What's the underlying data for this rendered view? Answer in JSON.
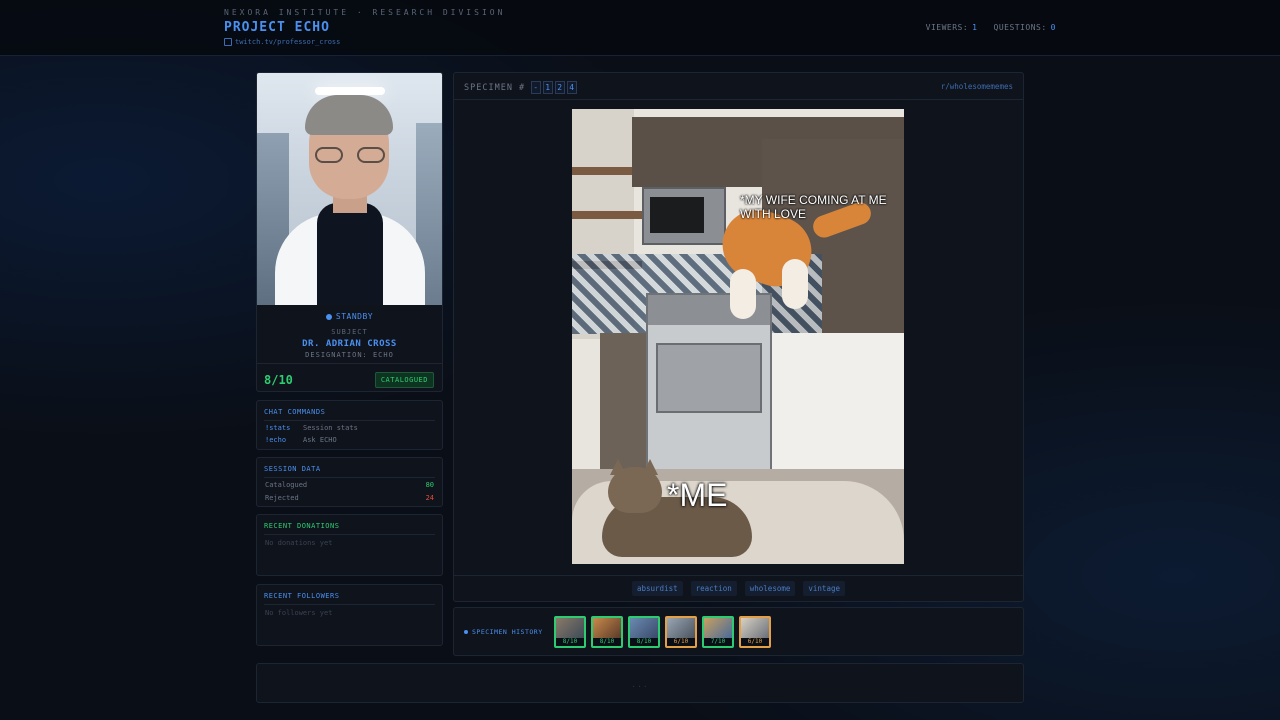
{
  "header": {
    "org": "NEXORA INSTITUTE · RESEARCH DIVISION",
    "title": "PROJECT ECHO",
    "channel": "twitch.tv/professor_cross",
    "viewers_label": "VIEWERS:",
    "viewers": "1",
    "questions_label": "QUESTIONS:",
    "questions": "0"
  },
  "subject": {
    "status": "STANDBY",
    "label": "SUBJECT",
    "name": "DR. ADRIAN CROSS",
    "designation": "DESIGNATION: ECHO",
    "score": "8/10",
    "badge": "CATALOGUED"
  },
  "commands": {
    "title": "CHAT COMMANDS",
    "items": [
      {
        "cmd": "!stats",
        "desc": "Session stats"
      },
      {
        "cmd": "!echo",
        "desc": "Ask ECHO"
      }
    ]
  },
  "session": {
    "title": "SESSION DATA",
    "catalogued_label": "Catalogued",
    "catalogued": "80",
    "rejected_label": "Rejected",
    "rejected": "24",
    "colors": {
      "catalogued": "#2ecc71",
      "rejected": "#e74c3c"
    }
  },
  "donations": {
    "title": "RECENT DONATIONS",
    "empty": "No donations yet"
  },
  "followers": {
    "title": "RECENT FOLLOWERS",
    "empty": "No followers yet"
  },
  "specimen": {
    "label": "SPECIMEN #",
    "digits": [
      "-",
      "1",
      "2",
      "4"
    ],
    "subreddit": "r/wholesomememes",
    "caption_top": "*MY WIFE COMING AT ME WITH LOVE",
    "caption_bottom": "*ME",
    "tags": [
      "absurdist",
      "reaction",
      "wholesome",
      "vintage"
    ]
  },
  "history": {
    "label": "SPECIMEN HISTORY",
    "items": [
      {
        "score": "8/10",
        "status": "good"
      },
      {
        "score": "8/10",
        "status": "good"
      },
      {
        "score": "8/10",
        "status": "good"
      },
      {
        "score": "6/10",
        "status": "mid"
      },
      {
        "score": "7/10",
        "status": "good"
      },
      {
        "score": "6/10",
        "status": "mid"
      }
    ]
  },
  "footer": {
    "placeholder": "..."
  },
  "colors": {
    "accent": "#4a90f0",
    "good": "#2ecc71",
    "mid": "#e3a047",
    "bg": "#0a0e16"
  }
}
